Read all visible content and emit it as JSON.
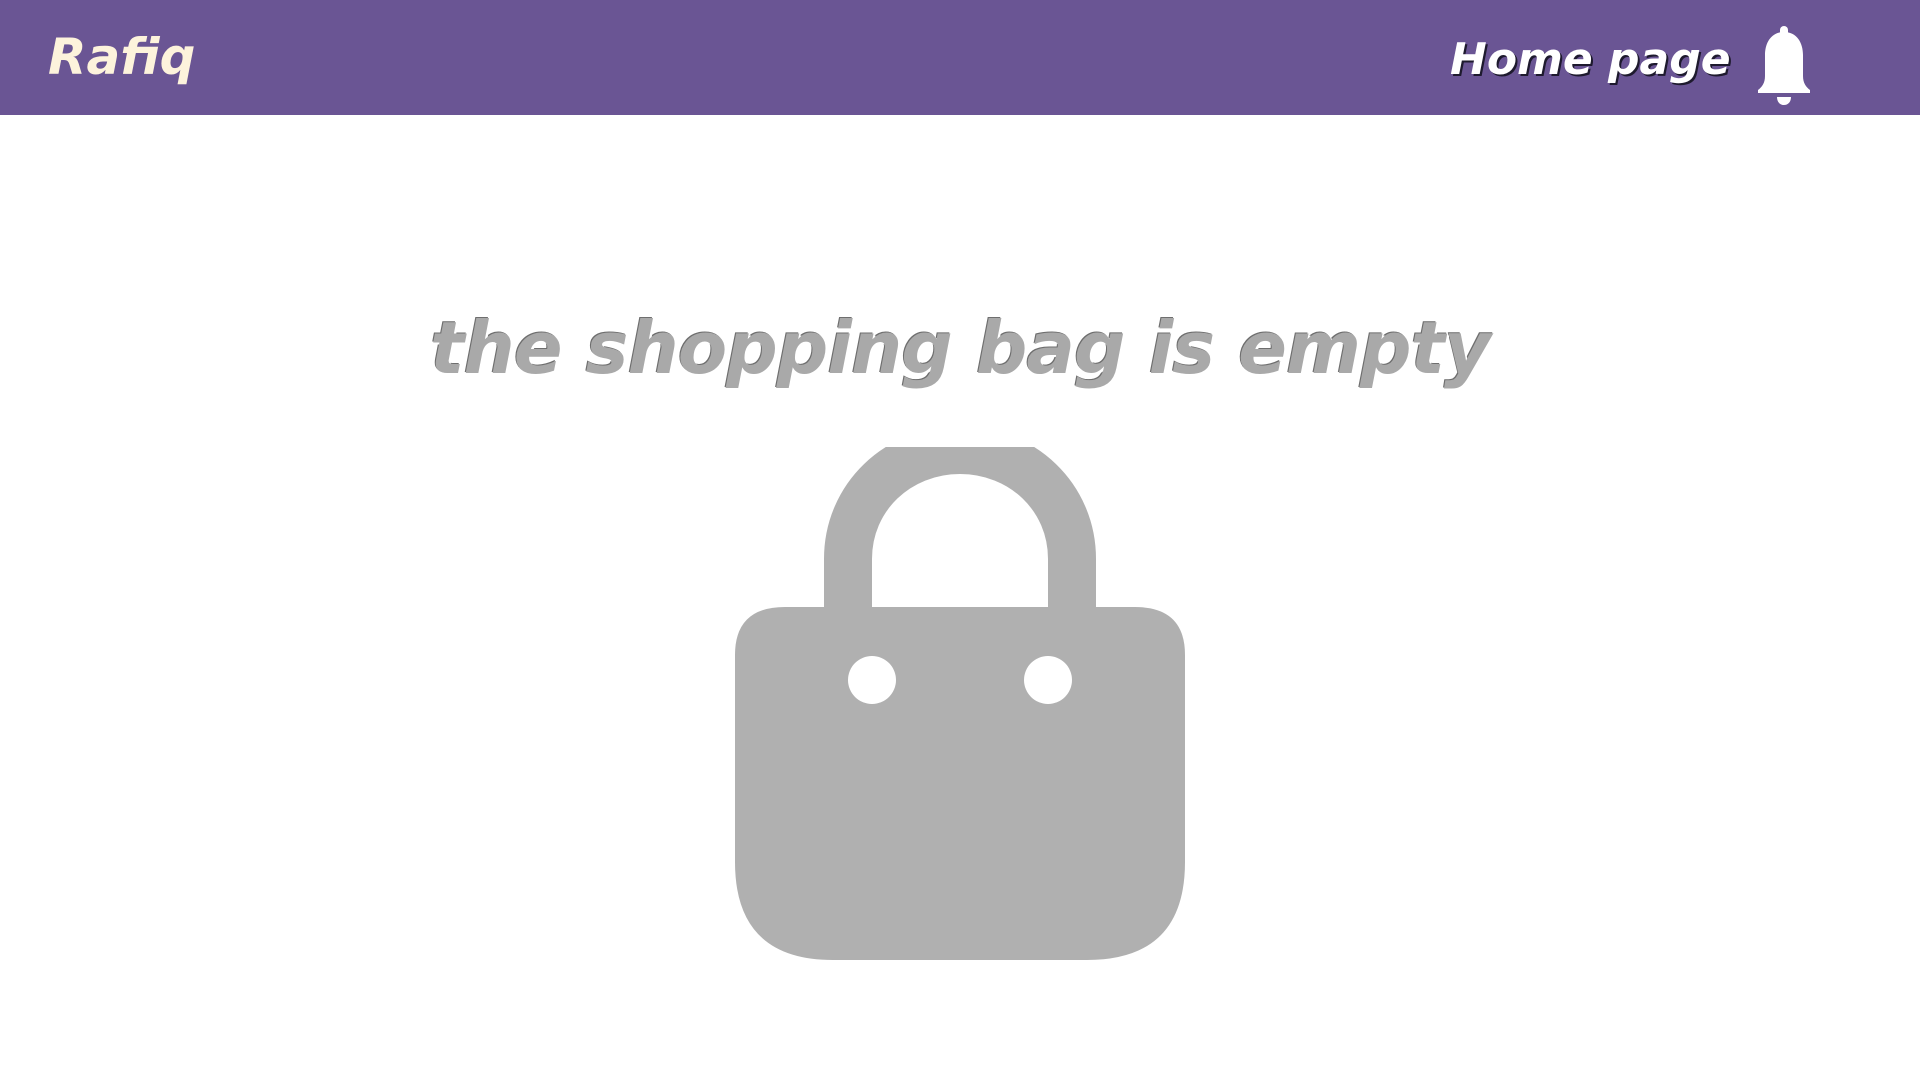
{
  "header": {
    "brand": "Rafiq",
    "nav_home": "Home page",
    "notification_icon": "bell-icon",
    "background_color": "#6a5594",
    "brand_color": "#fdf3dc"
  },
  "main": {
    "empty_message": "the shopping bag is empty",
    "illustration_icon": "shopping-bag-icon",
    "illustration_color": "#b0b0b0"
  }
}
